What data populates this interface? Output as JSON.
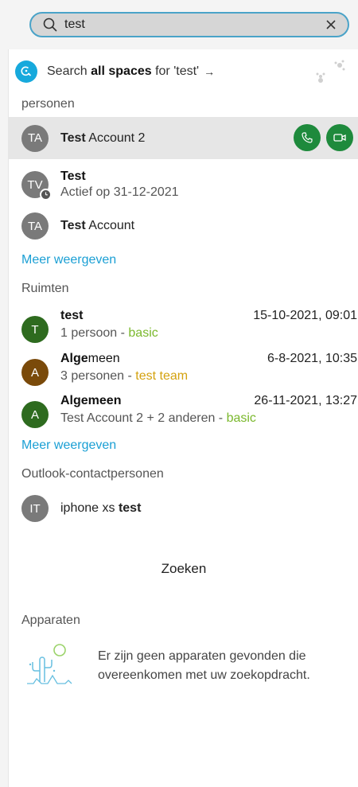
{
  "search": {
    "value": "test"
  },
  "all_spaces": {
    "prefix": "Search ",
    "bold": "all spaces",
    "suffix": " for 'test'",
    "arrow": "→"
  },
  "people": {
    "heading": "personen",
    "items": [
      {
        "initials": "TA",
        "bold": "Test",
        "rest": " Account 2",
        "selected": true
      },
      {
        "initials": "TV",
        "line1": "Test",
        "line2": "Actief op 31-12-2021"
      },
      {
        "initials": "TA",
        "bold": "Test",
        "rest": " Account"
      }
    ],
    "more": "Meer weergeven"
  },
  "spaces": {
    "heading": "Ruimten",
    "items": [
      {
        "initial": "T",
        "title": "test",
        "date": "15-10-2021, 09:01",
        "sub": "1 persoon - ",
        "team": "basic",
        "color": "#2e6b1f",
        "team_color": "#7ab82c"
      },
      {
        "initial": "A",
        "title_bold": "Alge",
        "title_rest": "meen",
        "date": "6-8-2021, 10:35",
        "sub": "3 personen - ",
        "team": "test team",
        "color": "#7a4a0a",
        "team_color": "#d4a20f"
      },
      {
        "initial": "A",
        "title": "Algemeen",
        "date": "26-11-2021, 13:27",
        "sub": "Test Account 2 + 2 anderen - ",
        "team": "basic",
        "color": "#2e6b1f",
        "team_color": "#7ab82c"
      }
    ],
    "more": "Meer weergeven"
  },
  "outlook": {
    "heading": "Outlook-contactpersonen",
    "items": [
      {
        "initials": "IT",
        "rest": "iphone xs ",
        "bold": "test"
      }
    ]
  },
  "search_button": "Zoeken",
  "devices": {
    "heading": "Apparaten",
    "empty": "Er zijn geen apparaten gevonden die overeenkomen met uw zoekopdracht."
  },
  "colors": {
    "accent": "#1a9fd4",
    "call_green": "#1e8a3c"
  }
}
